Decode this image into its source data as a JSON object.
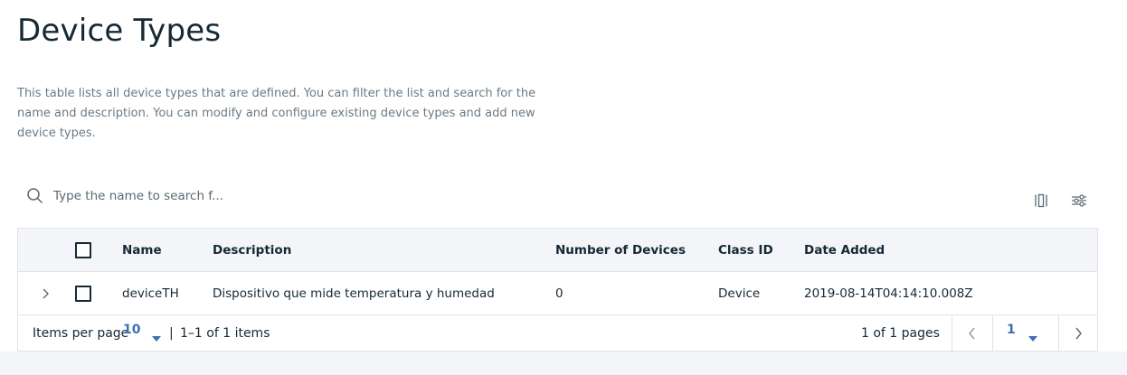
{
  "page": {
    "title": "Device Types",
    "description": "This table lists all device types that are defined. You can filter the list and search for the name and description. You can modify and configure existing device types and add new device types."
  },
  "search": {
    "placeholder": "Type the name to search f...",
    "icon": "search-icon"
  },
  "toolbar": {
    "columns_icon": "column-selector-icon",
    "filter_icon": "filter-settings-icon"
  },
  "table": {
    "columns": [
      "Name",
      "Description",
      "Number of Devices",
      "Class ID",
      "Date Added"
    ],
    "rows": [
      {
        "name": "deviceTH",
        "description": "Dispositivo que mide temperatura y humedad",
        "devices": "0",
        "class_id": "Device",
        "date_added": "2019-08-14T04:14:10.008Z"
      }
    ]
  },
  "pagination": {
    "items_per_page_label": "Items per page",
    "items_per_page_value": "10",
    "separator": "|",
    "range_text": "1–1 of 1 items",
    "pages_text": "1 of 1 pages",
    "current_page": "1"
  },
  "colors": {
    "text": "#152935",
    "muted": "#6a7a86",
    "accent": "#3d70b2",
    "border": "#dfe3e6",
    "header_bg": "#f4f5f9"
  }
}
